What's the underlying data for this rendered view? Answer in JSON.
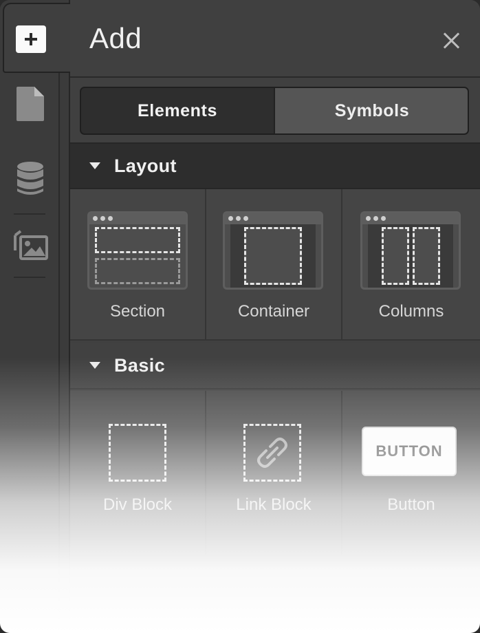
{
  "rail": {
    "icons": [
      "plus-icon",
      "page-icon",
      "database-icon",
      "assets-icon"
    ]
  },
  "panel": {
    "title": "Add",
    "close_icon": "close-icon"
  },
  "tabs": {
    "elements": "Elements",
    "symbols": "Symbols",
    "active": "Elements"
  },
  "sections": {
    "layout": {
      "label": "Layout",
      "items": [
        {
          "label": "Section",
          "icon": "section-icon"
        },
        {
          "label": "Container",
          "icon": "container-icon"
        },
        {
          "label": "Columns",
          "icon": "columns-icon"
        }
      ]
    },
    "basic": {
      "label": "Basic",
      "items": [
        {
          "label": "Div Block",
          "icon": "div-block-icon"
        },
        {
          "label": "Link Block",
          "icon": "link-block-icon"
        },
        {
          "label": "Button",
          "icon": "button-preview-icon",
          "preview_text": "BUTTON"
        }
      ]
    }
  }
}
